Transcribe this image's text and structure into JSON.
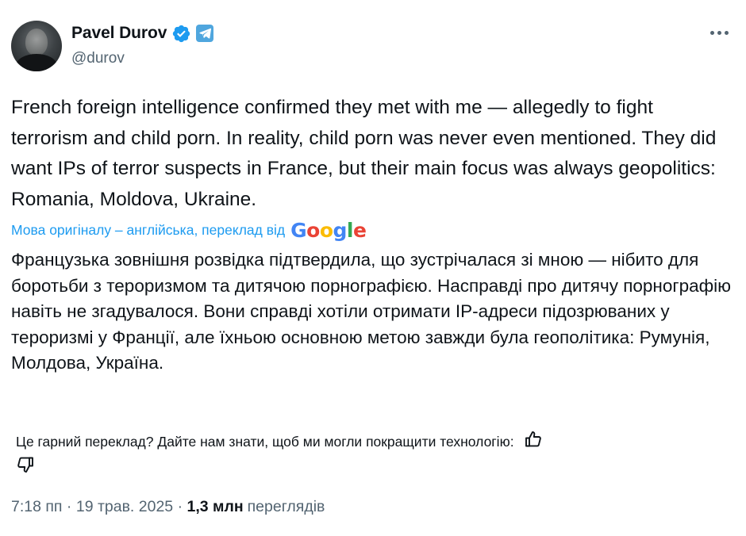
{
  "author": {
    "display_name": "Pavel Durov",
    "handle": "@durov",
    "verified_icon": "verified-badge-icon",
    "affiliation_icon": "telegram-icon"
  },
  "tweet": {
    "text": "French foreign intelligence confirmed they met with me — allegedly to fight terrorism and child porn. In reality, child porn was never even mentioned. They did want IPs of terror suspects in France, but their main focus was always geopolitics: Romania, Moldova, Ukraine."
  },
  "translation": {
    "source_note": "Мова оригіналу – англійська, переклад від",
    "provider": "Google",
    "text": "Французька зовнішня розвідка підтвердила, що зустрічалася зі мною — нібито для боротьби з тероризмом та дитячою порнографією. Насправді про дитячу порнографію навіть не згадувалося. Вони справді хотіли отримати IP-адреси підозрюваних у тероризмі у Франції, але їхньою основною метою завжди була геополітика: Румунія, Молдова, Україна.",
    "feedback_prompt": "Це гарний переклад? Дайте нам знати, щоб ми могли покращити технологію:"
  },
  "meta": {
    "time": "7:18 пп",
    "date": "19 трав. 2025",
    "separator": " · ",
    "views_count": "1,3 млн",
    "views_label": "переглядів"
  },
  "colors": {
    "link": "#1d9bf0",
    "verified": "#1d9bf0",
    "telegram": "#4fa6de",
    "secondary_text": "#536471",
    "google_blue": "#4285f4",
    "google_red": "#ea4335",
    "google_yellow": "#fbbc05",
    "google_green": "#34a853"
  }
}
